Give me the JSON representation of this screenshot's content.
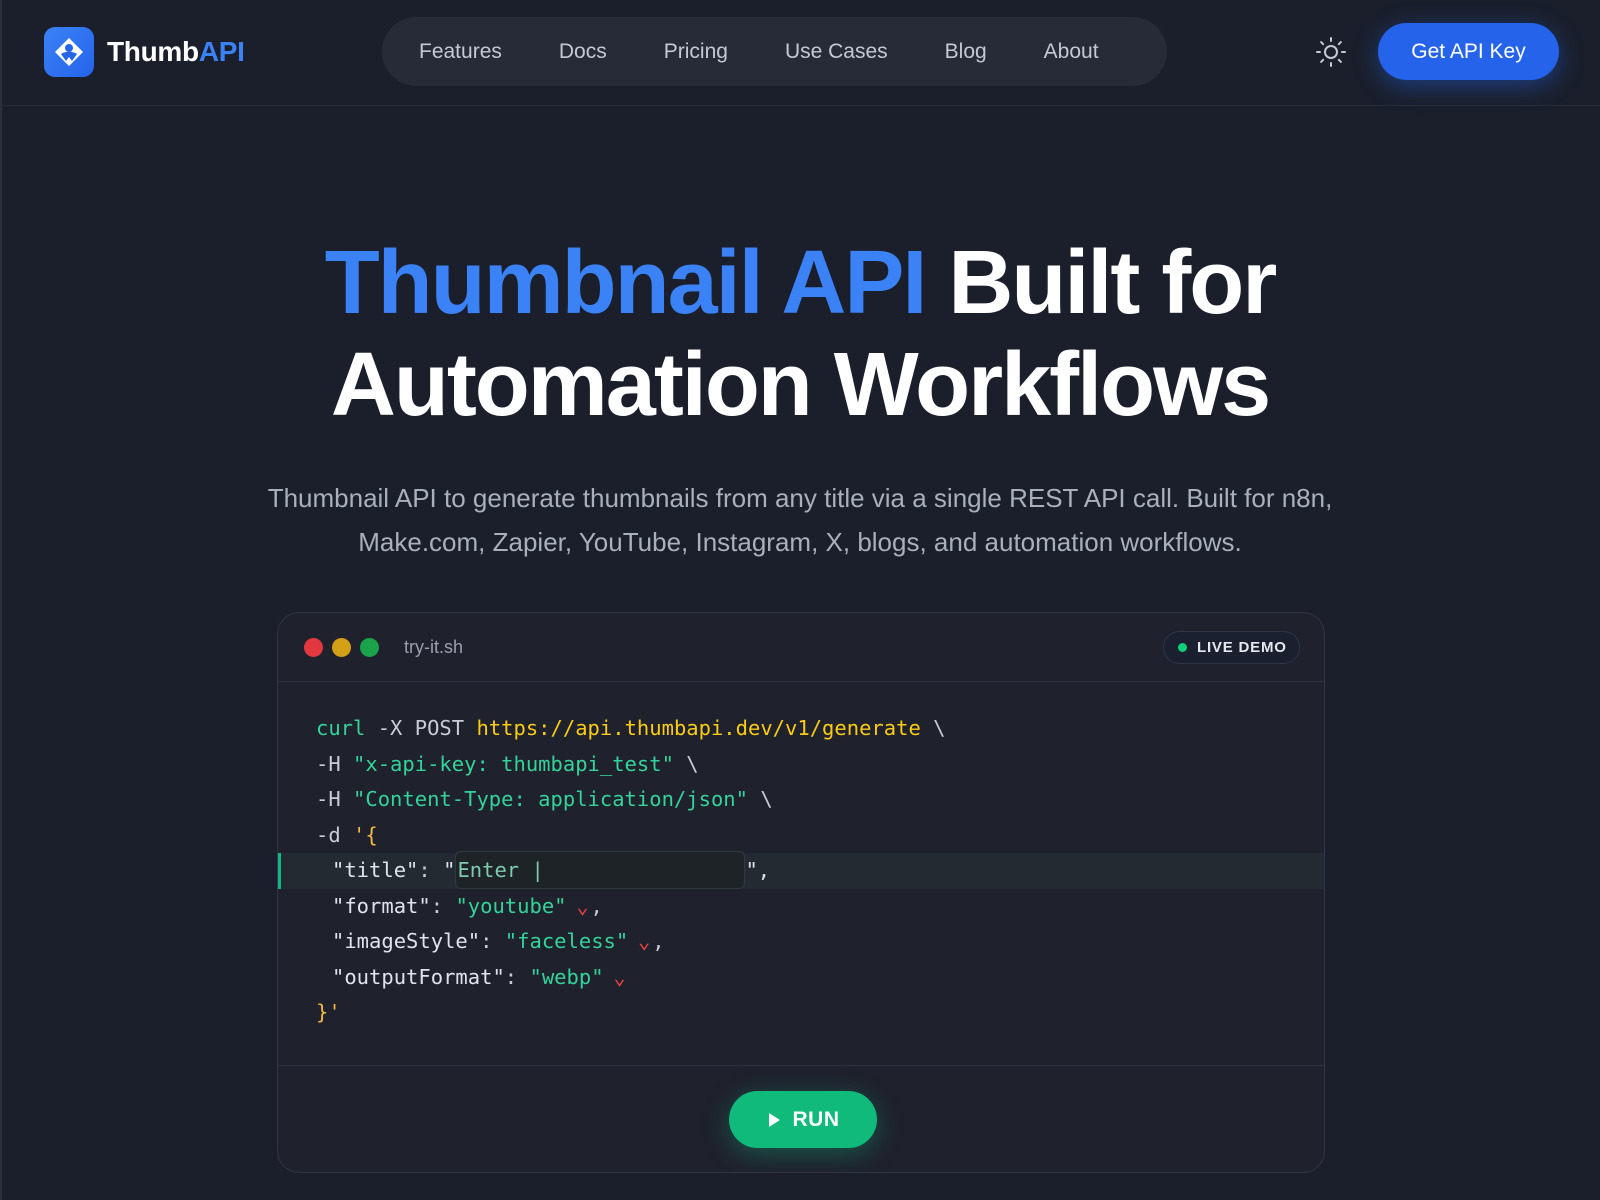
{
  "brand": {
    "name_part1": "Thumb",
    "name_part2": "API"
  },
  "nav": {
    "items": [
      "Features",
      "Docs",
      "Pricing",
      "Use Cases",
      "Blog",
      "About"
    ]
  },
  "header": {
    "cta_label": "Get API Key",
    "theme_icon": "sun-icon"
  },
  "hero": {
    "title_accent": "Thumbnail API",
    "title_rest_line1": " Built for",
    "title_line2": "Automation Workflows",
    "subtitle_line1": "Thumbnail API to generate thumbnails from any title via a single REST API call. Built for n8n,",
    "subtitle_line2": "Make.com, Zapier, YouTube, Instagram, X, blogs, and automation workflows."
  },
  "terminal": {
    "filename": "try-it.sh",
    "badge": "LIVE DEMO",
    "code": {
      "cmd": "curl",
      "method_flag": " -X POST ",
      "url": "https://api.thumbapi.dev/v1/generate",
      "cont": " \\",
      "h_flag": "-H ",
      "header1": "\"x-api-key: thumbapi_test\"",
      "header2": "\"Content-Type: application/json\"",
      "d_flag": "-d ",
      "open": "'{",
      "title_key": "\"title\"",
      "colon": ": ",
      "quote_open": "\"",
      "title_value": "Enter |",
      "quote_close_comma": "\",",
      "format_key": "\"format\"",
      "format_value": "\"youtube\"",
      "imageStyle_key": "\"imageStyle\"",
      "imageStyle_value": "\"faceless\"",
      "outputFormat_key": "\"outputFormat\"",
      "outputFormat_value": "\"webp\"",
      "comma": ",",
      "close": "}'",
      "chevron": "⌄"
    },
    "run_label": "RUN"
  },
  "colors": {
    "background": "#1a1f2b",
    "accent": "#3b82f6",
    "run_green": "#0fba7a",
    "live_dot": "#10d07a"
  }
}
